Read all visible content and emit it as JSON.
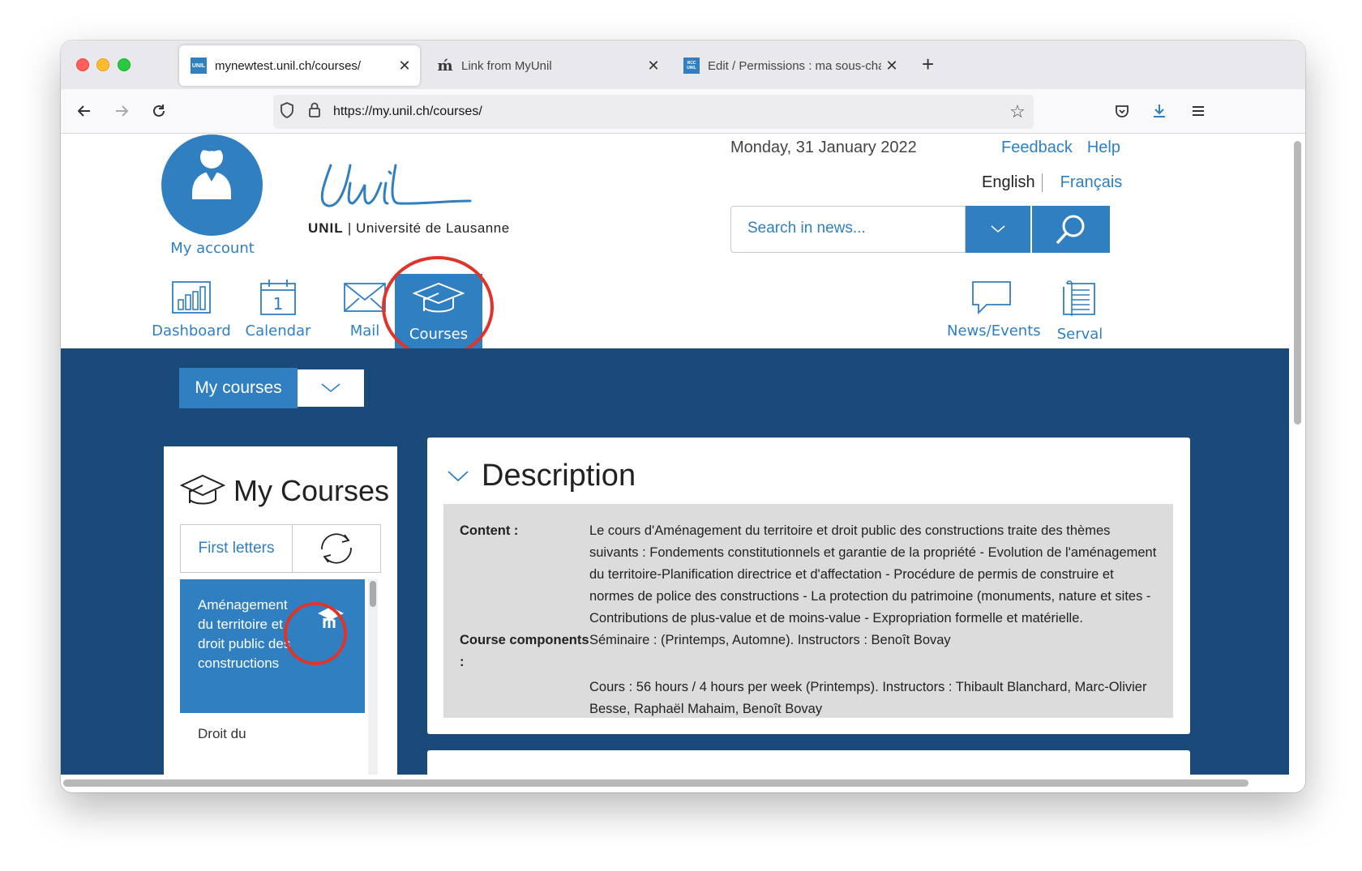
{
  "browser": {
    "tabs": [
      {
        "favicon": "UNIL",
        "label": "mynewtest.unil.ch/courses/",
        "active": true
      },
      {
        "favicon": "ḿ",
        "label": "Link from MyUnil",
        "active": false
      },
      {
        "favicon": "RCC UNIL",
        "label": "Edit / Permissions : ma sous-cha",
        "active": false
      }
    ],
    "url": "https://my.unil.ch/courses/"
  },
  "header": {
    "account_label": "My account",
    "university_short": "UNIL",
    "university_full": "Université de Lausanne",
    "date": "Monday, 31 January 2022",
    "feedback": "Feedback",
    "help": "Help",
    "lang_en": "English",
    "lang_fr": "Français",
    "search_placeholder": "Search in news..."
  },
  "nav": {
    "dashboard": "Dashboard",
    "calendar": "Calendar",
    "calendar_day": "1",
    "mail": "Mail",
    "courses": "Courses",
    "news": "News/Events",
    "serval": "Serval"
  },
  "main": {
    "my_courses_btn": "My courses",
    "panel_title": "My Courses",
    "first_letters": "First letters",
    "courses": [
      {
        "name": "Aménagement du territoire et droit public des constructions",
        "active": true
      },
      {
        "name": "Droit du",
        "active": false
      }
    ],
    "description": {
      "title": "Description",
      "content_label": "Content :",
      "content_text": "Le cours d'Aménagement du territoire et droit public des constructions traite des thèmes suivants : Fondements constitutionnels et garantie de la propriété - Evolution de l'aménagement du territoire-Planification directrice et d'affectation - Procédure de permis de construire et normes de police des constructions - La protection du patrimoine (monuments, nature et sites - Contributions de plus-value et de moins-value - Expropriation formelle et matérielle.",
      "components_label": "Course components :",
      "component1": "Séminaire : (Printemps, Automne). Instructors : Benoît Bovay",
      "component2": "Cours : 56 hours / 4 hours per week (Printemps). Instructors : Thibault Blanchard, Marc-Olivier Besse, Raphaël Mahaim, Benoît Bovay"
    }
  },
  "colors": {
    "accent": "#2f7fc1",
    "band": "#1a4a79",
    "highlight": "#e0342a"
  }
}
